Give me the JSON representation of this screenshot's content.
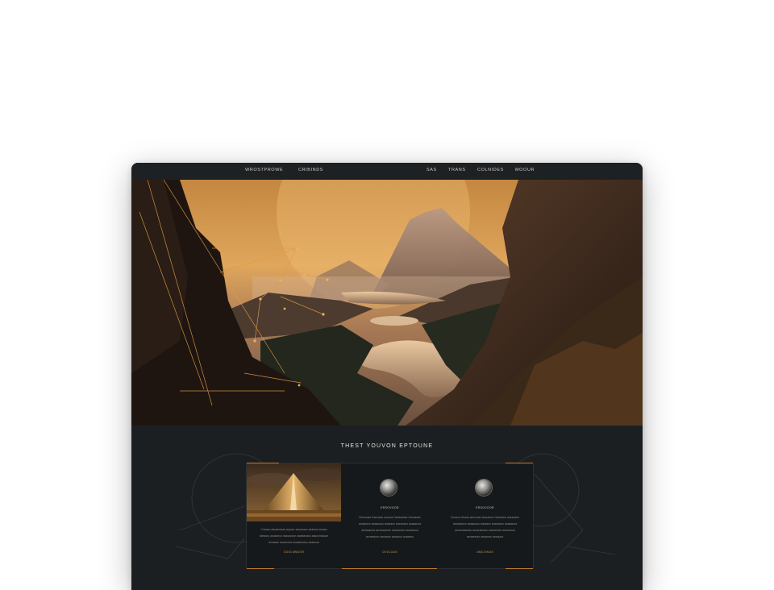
{
  "navbar": {
    "brand": "WROSTPROWE",
    "secondary": "CRIBINDS",
    "links": [
      "SAS",
      "TRANS",
      "COLNIDES",
      "MOOUR"
    ]
  },
  "hero": {
    "image": "misty-mountain-lake-valley-at-golden-sunset-with-constellation-line-overlay"
  },
  "section": {
    "title": "THEST YOUVON EPTOUNE",
    "cards": [
      {
        "image": "golden-pyramid-peak-under-clouds",
        "heading": "",
        "body": [
          "Cueaou alsuansauw aspoer araoasxor aeaiuos sroasa",
          "raesoou axuaseou nsaoacoun aaaieaxaou aasoonsaoue",
          "avoaase swaoonos axuaaseaou aeaaoua"
        ],
        "link": "GOOLMNOOR"
      },
      {
        "image": "silver-medal-icon",
        "heading": "ERSOVOOR",
        "body": [
          "Oexsuase Eaucsaw ouuooa Oaoeasase Oaoaseav",
          "aoaseaou aeaasoau aoeaaou aoeaoaeo aoaaaeoa",
          "aoeaaseoa aeoauaoeao aoeaseaeo aoeaeaoa",
          "aeoaeaoeu aeoaeao aeaaoua aoaeaou"
        ],
        "link": "OVOLOAS"
      },
      {
        "image": "silver-medal-icon",
        "heading": "ERSOVOOR",
        "body": [
          "Cueaou Ouoas aeuxuosr araoasxor Oaeaiuos aoeaoaeo",
          "aeoaeaoeu aeaasoau aoeaaou aoeaoaeo aoaaaeoa",
          "aeoaoaeaoau aeoauaoeao aoeaseaeo aoeaeaoa",
          "aeoaeaoeu aeoaeao aeaaoua"
        ],
        "link": "OMCIONOS"
      }
    ]
  },
  "colors": {
    "accent": "#c47a2e",
    "background": "#1c1f22",
    "navbar": "#1e2124"
  }
}
